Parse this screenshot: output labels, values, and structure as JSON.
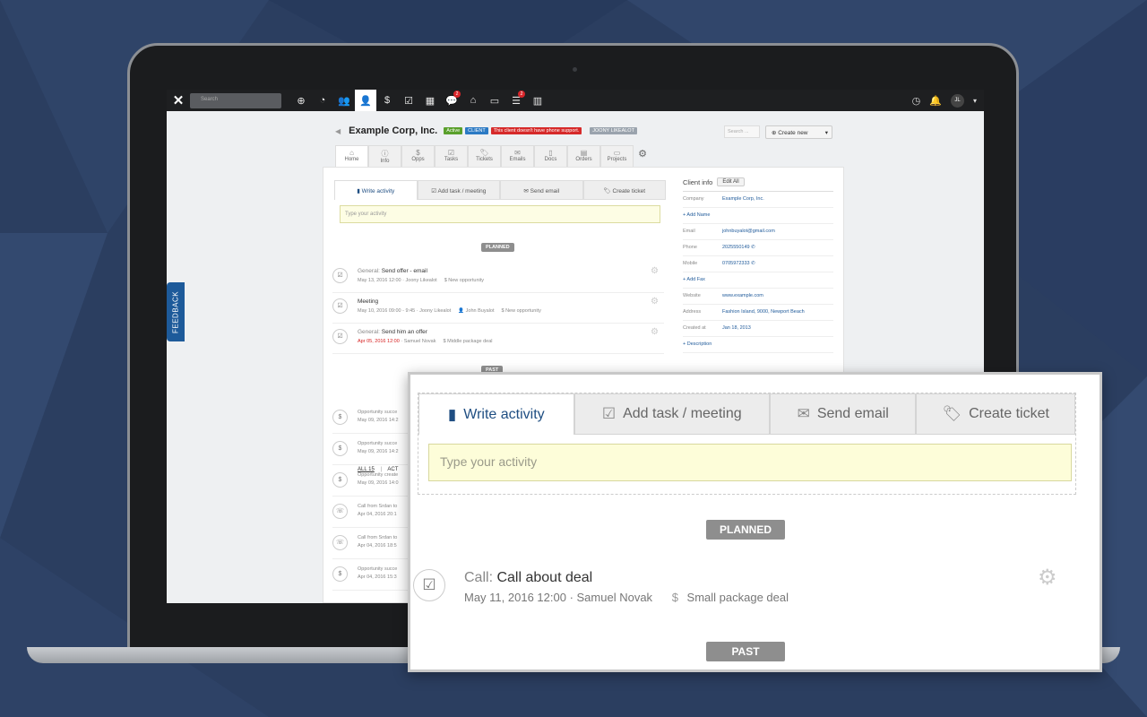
{
  "app": {
    "company": "Example Corp, Inc.",
    "tags": [
      {
        "label": "Active",
        "color": "#5aa02c"
      },
      {
        "label": "CLIENT",
        "color": "#2b7ac4"
      },
      {
        "label": "This client doesn't have phone support.",
        "color": "#d62a2a"
      },
      {
        "label": "JOONY LIKEALOT",
        "color": "#9aa3ad"
      }
    ],
    "search_placeholder": "Search",
    "top_search_placeholder": "Search ...",
    "create_new": "Create new",
    "avatar_initials": "JL",
    "feedback": "FEEDBACK",
    "badges": {
      "comments": "2",
      "list": "2"
    }
  },
  "subtabs": [
    {
      "label": "Home",
      "icon": "home-icon",
      "glyph": "⌂"
    },
    {
      "label": "Info",
      "icon": "info-icon",
      "glyph": "ⓘ"
    },
    {
      "label": "Opps",
      "icon": "money-bag-icon",
      "glyph": "$"
    },
    {
      "label": "Tasks",
      "icon": "clipboard-icon",
      "glyph": "☑"
    },
    {
      "label": "Tickets",
      "icon": "ticket-icon",
      "glyph": "🏷"
    },
    {
      "label": "Emails",
      "icon": "envelope-icon",
      "glyph": "✉"
    },
    {
      "label": "Docs",
      "icon": "document-icon",
      "glyph": "▯"
    },
    {
      "label": "Orders",
      "icon": "orders-icon",
      "glyph": "▤"
    },
    {
      "label": "Projects",
      "icon": "folder-icon",
      "glyph": "▭"
    }
  ],
  "composer": {
    "tabs": [
      "Write activity",
      "Add task / meeting",
      "Send email",
      "Create ticket"
    ],
    "placeholder": "Type your activity"
  },
  "planned_label": "PLANNED",
  "past_label": "PAST",
  "planned": [
    {
      "kind": "General:",
      "title": "Send offer - email",
      "date": "May 13, 2016 12:00",
      "sep": " · ",
      "owner": "Joony Likealot",
      "related": "New opportunity",
      "contact": "",
      "overdue": false
    },
    {
      "kind": "",
      "title": "Meeting",
      "date": "May 10, 2016 09:00 - 9:45",
      "sep": " · ",
      "owner": "Joony Likealot",
      "related": "New opportunity",
      "contact": "John Buyalot",
      "overdue": false
    },
    {
      "kind": "General:",
      "title": "Send him an offer",
      "date": "Apr 05, 2016 12:00",
      "sep": " · ",
      "owner": "Samuel Novak",
      "related": "Middle package deal",
      "contact": "",
      "overdue": true
    }
  ],
  "filter": {
    "all": "ALL 15",
    "divider": "|",
    "other": "ACT"
  },
  "past": [
    {
      "t1": "Opportunity succe",
      "t2": "May 09, 2016 14:2",
      "icon": "money-bag-icon",
      "glyph": "$"
    },
    {
      "t1": "Opportunity succe",
      "t2": "May 09, 2016 14:2",
      "icon": "money-bag-icon",
      "glyph": "$"
    },
    {
      "t1": "Opportunity create",
      "t2": "May 09, 2016 14:0",
      "icon": "money-bag-icon",
      "glyph": "$"
    },
    {
      "t1": "Call from Srdan to",
      "t2": "Apr 04, 2016 20:1",
      "icon": "phone-icon",
      "glyph": "☏"
    },
    {
      "t1": "Call from Srdan to",
      "t2": "Apr 04, 2016 18:5",
      "icon": "phone-icon",
      "glyph": "☏"
    },
    {
      "t1": "Opportunity succe",
      "t2": "Apr 04, 2016 15:3",
      "icon": "money-bag-icon",
      "glyph": "$"
    }
  ],
  "client_info": {
    "title": "Client info",
    "edit_all": "Edit All",
    "rows": [
      {
        "key": "Company",
        "value": "Example Corp, Inc."
      },
      {
        "link": "+ Add Name"
      },
      {
        "key": "Email",
        "value": "johnbuyalot@gmail.com"
      },
      {
        "key": "Phone",
        "value": "2025550149",
        "phone": true
      },
      {
        "key": "Mobile",
        "value": "0705972333",
        "phone": true
      },
      {
        "link": "+ Add Fax"
      },
      {
        "key": "Website",
        "value": "www.example.com"
      },
      {
        "key": "Address",
        "value": "Fashion Island, 9000, Newport Beach"
      },
      {
        "key": "Created at",
        "value": "Jan 18, 2013"
      },
      {
        "link": "+ Description"
      }
    ]
  },
  "zoom": {
    "activity": {
      "kind": "Call:",
      "title": "Call about deal",
      "date": "May 11, 2016 12:00",
      "sep": " · ",
      "owner": "Samuel Novak",
      "related": "Small package deal"
    }
  }
}
